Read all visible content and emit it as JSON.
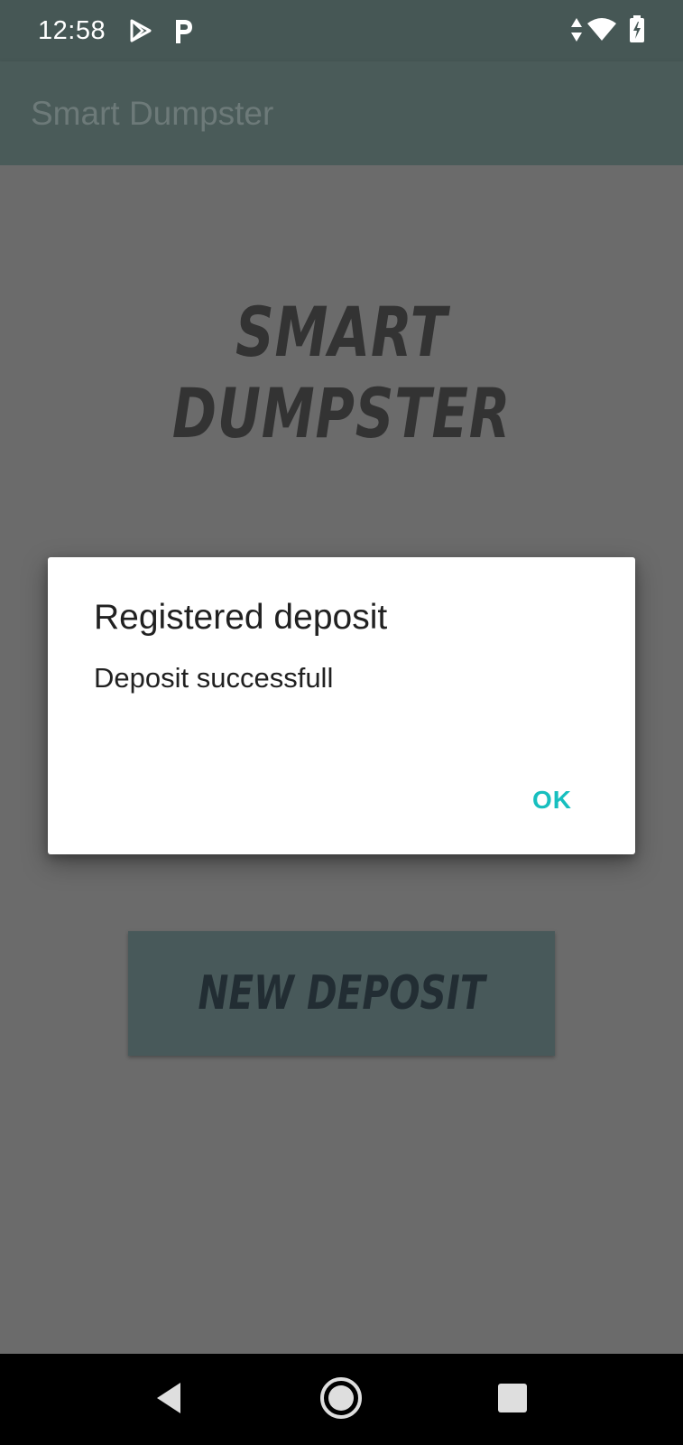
{
  "status_bar": {
    "time": "12:58",
    "icons": [
      "play-store-icon",
      "p-app-icon",
      "data-arrows-icon",
      "wifi-icon",
      "battery-charging-icon"
    ]
  },
  "app_bar": {
    "title": "Smart Dumpster"
  },
  "main": {
    "logo_text": "Smart Dumpster",
    "new_deposit_label": "New Deposit"
  },
  "dialog": {
    "title": "Registered deposit",
    "message": "Deposit successfull",
    "ok_label": "OK"
  },
  "nav_bar": {
    "buttons": [
      "back-icon",
      "home-icon",
      "recents-icon"
    ]
  },
  "colors": {
    "status_bar": "#465755",
    "app_bar": "#4a5b59",
    "scrim_background": "#6b6b6b",
    "accent": "#17bfbf",
    "button": "#48595a"
  }
}
